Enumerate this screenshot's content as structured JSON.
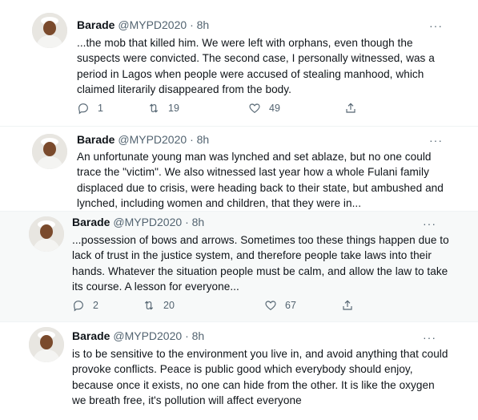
{
  "tweets": [
    {
      "name": "Barade",
      "handle": "@MYPD2020",
      "dot": "·",
      "time": "8h",
      "text": "...the mob that killed him. We were left with orphans, even though the suspects were convicted. The second case, I personally witnessed, was a period in Lagos when people were accused of stealing manhood, which claimed literarily disappeared from the body.",
      "replies": "1",
      "retweets": "19",
      "likes": "49",
      "more": "···"
    },
    {
      "name": "Barade",
      "handle": "@MYPD2020",
      "dot": "·",
      "time": "8h",
      "text": "An unfortunate young man was lynched and set ablaze, but no one could trace the \"victim\". We also witnessed last year how a whole Fulani family displaced due to crisis, were heading back to their state, but ambushed and lynched, including women and children, that they were in...",
      "more": "···"
    },
    {
      "name": "Barade",
      "handle": "@MYPD2020",
      "dot": "·",
      "time": "8h",
      "text": "...possession of bows and arrows. Sometimes too these things happen due to lack of trust in the justice system, and therefore people take laws into their hands. Whatever the situation people must be calm, and allow the law to take its course. A lesson for everyone...",
      "replies": "2",
      "retweets": "20",
      "likes": "67",
      "more": "···"
    },
    {
      "name": "Barade",
      "handle": "@MYPD2020",
      "dot": "·",
      "time": "8h",
      "text": "is to be sensitive to the environment you live in, and avoid anything that could provoke conflicts. Peace is public good which everybody should enjoy, because once it exists, no one can hide from the other. It is like the oxygen we breath free, it's pollution will affect everyone",
      "more": "···"
    }
  ],
  "colors": {
    "text": "#0f1419",
    "secondary": "#536471",
    "divider": "#eff3f4",
    "highlight_bg": "#f7f9f9"
  },
  "icons": {
    "reply": "reply-icon",
    "retweet": "retweet-icon",
    "like": "heart-icon",
    "share": "share-icon",
    "more": "more-icon"
  }
}
